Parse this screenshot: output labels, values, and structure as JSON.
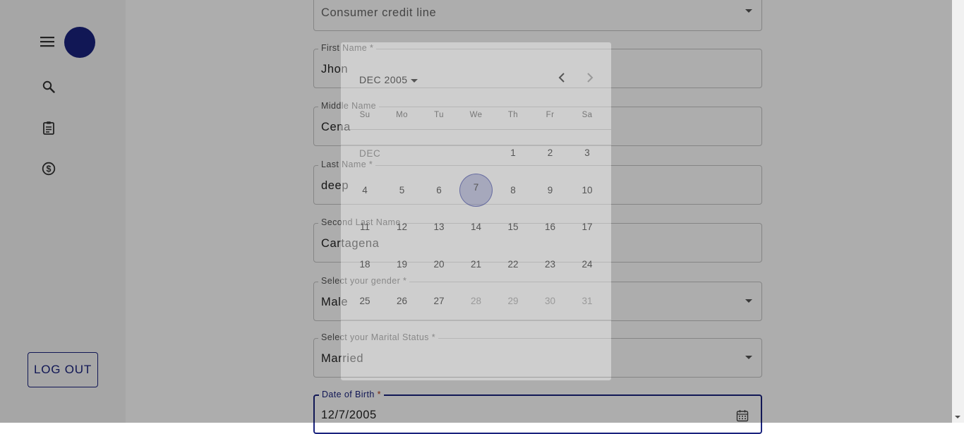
{
  "sidebar": {
    "logout_label": "LOG OUT",
    "icons": [
      "menu-icon",
      "avatar",
      "search-icon",
      "clipboard-icon",
      "dollar-circle-icon"
    ]
  },
  "form": {
    "credit_line": {
      "placeholder": "Consumer credit line"
    },
    "first_name": {
      "label": "First Name",
      "required": "*",
      "value": "Jhon"
    },
    "middle_name": {
      "label": "Middle Name",
      "value": "Cena"
    },
    "last_name": {
      "label": "Last Name",
      "required": "*",
      "value": "deep"
    },
    "second_last_name": {
      "label": "Second Last Name",
      "value": "Cartagena"
    },
    "gender": {
      "label": "Select your gender",
      "required": "*",
      "value": "Male"
    },
    "marital_status": {
      "label": "Select your Marital Status",
      "required": "*",
      "value": "Married"
    },
    "date_of_birth": {
      "label": "Date of Birth",
      "required": "*",
      "value": "12/7/2005"
    }
  },
  "datepicker": {
    "header": "DEC 2005",
    "month_label": "DEC",
    "weekdays": [
      "Su",
      "Mo",
      "Tu",
      "We",
      "Th",
      "Fr",
      "Sa"
    ],
    "first_weekday_index": 4,
    "days_in_month": 31,
    "selected_day": 7,
    "muted_from_day": 28,
    "prev_icon": "chevron-left-icon",
    "next_icon": "chevron-right-icon"
  },
  "colors": {
    "accent": "#1a237e",
    "required_focused": "#b23c17"
  }
}
